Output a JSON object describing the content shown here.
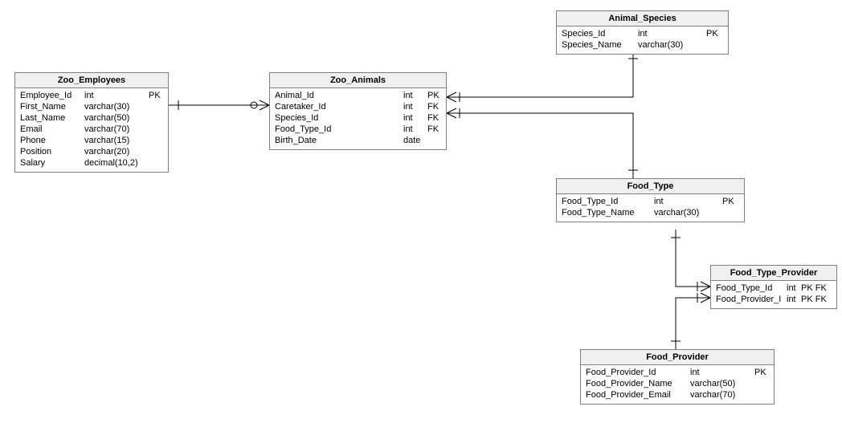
{
  "diagram_type": "entity-relationship",
  "entities": {
    "zoo_employees": {
      "title": "Zoo_Employees",
      "columns": [
        {
          "name": "Employee_Id",
          "type": "int",
          "key": "PK"
        },
        {
          "name": "First_Name",
          "type": "varchar(30)",
          "key": ""
        },
        {
          "name": "Last_Name",
          "type": "varchar(50)",
          "key": ""
        },
        {
          "name": "Email",
          "type": "varchar(70)",
          "key": ""
        },
        {
          "name": "Phone",
          "type": "varchar(15)",
          "key": ""
        },
        {
          "name": "Position",
          "type": "varchar(20)",
          "key": ""
        },
        {
          "name": "Salary",
          "type": "decimal(10,2)",
          "key": ""
        }
      ]
    },
    "zoo_animals": {
      "title": "Zoo_Animals",
      "columns": [
        {
          "name": "Animal_Id",
          "type": "int",
          "key": "PK"
        },
        {
          "name": "Caretaker_Id",
          "type": "int",
          "key": "FK"
        },
        {
          "name": "Species_Id",
          "type": "int",
          "key": "FK"
        },
        {
          "name": "Food_Type_Id",
          "type": "int",
          "key": "FK"
        },
        {
          "name": "Birth_Date",
          "type": "date",
          "key": ""
        }
      ]
    },
    "animal_species": {
      "title": "Animal_Species",
      "columns": [
        {
          "name": "Species_Id",
          "type": "int",
          "key": "PK"
        },
        {
          "name": "Species_Name",
          "type": "varchar(30)",
          "key": ""
        }
      ]
    },
    "food_type": {
      "title": "Food_Type",
      "columns": [
        {
          "name": "Food_Type_Id",
          "type": "int",
          "key": "PK"
        },
        {
          "name": "Food_Type_Name",
          "type": "varchar(30)",
          "key": ""
        }
      ]
    },
    "food_type_provider": {
      "title": "Food_Type_Provider",
      "columns": [
        {
          "name": "Food_Type_Id",
          "type": "int",
          "key": "PK FK"
        },
        {
          "name": "Food_Provider_I",
          "type": "int",
          "key": "PK FK"
        }
      ]
    },
    "food_provider": {
      "title": "Food_Provider",
      "columns": [
        {
          "name": "Food_Provider_Id",
          "type": "int",
          "key": "PK"
        },
        {
          "name": "Food_Provider_Name",
          "type": "varchar(50)",
          "key": ""
        },
        {
          "name": "Food_Provider_Email",
          "type": "varchar(70)",
          "key": ""
        }
      ]
    }
  },
  "relationships": [
    {
      "from": "zoo_employees",
      "to": "zoo_animals",
      "from_card": "one",
      "to_card": "many-optional"
    },
    {
      "from": "animal_species",
      "to": "zoo_animals",
      "from_card": "one",
      "to_card": "many"
    },
    {
      "from": "food_type",
      "to": "zoo_animals",
      "from_card": "one",
      "to_card": "many"
    },
    {
      "from": "food_type",
      "to": "food_type_provider",
      "from_card": "one",
      "to_card": "many"
    },
    {
      "from": "food_provider",
      "to": "food_type_provider",
      "from_card": "one",
      "to_card": "many"
    }
  ]
}
